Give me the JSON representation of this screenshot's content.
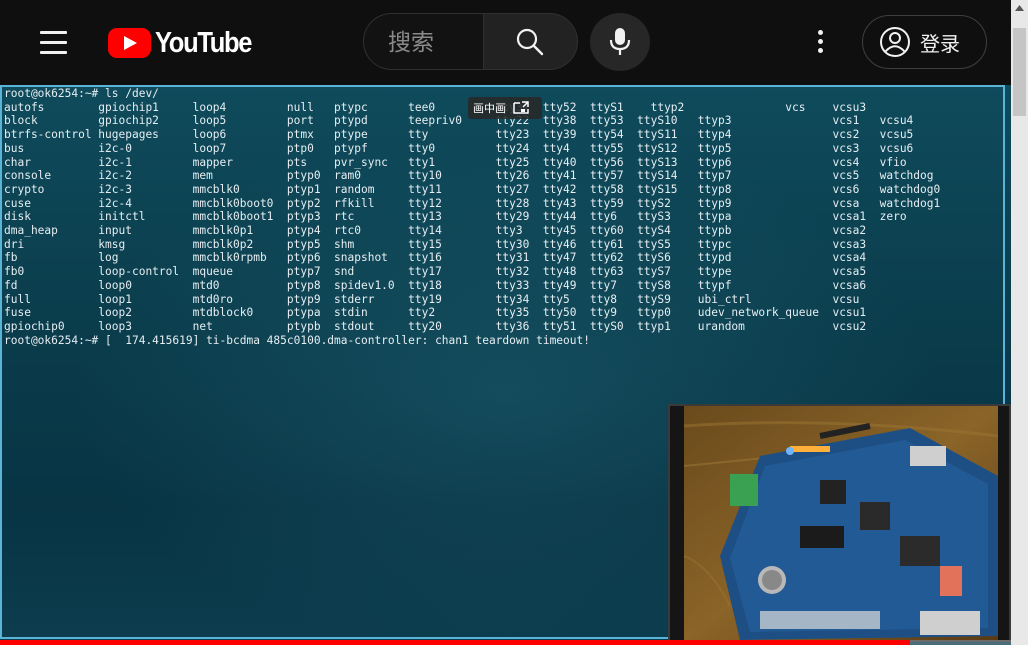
{
  "header": {
    "logo_text": "YouTube",
    "search_placeholder": "搜索",
    "login_label": "登录"
  },
  "video": {
    "pip_badge_label": "画中画",
    "progress_fraction": 0.9,
    "terminal_lines": [
      "root@ok6254:~# ls /dev/",
      "autofs        gpiochip1     loop4         null   ptypc      tee0         tty37  tty52  ttyS1    ttyp2               vcs    vcsu3",
      "block         gpiochip2     loop5         port   ptypd      teepriv0     tty22  tty38  tty53  ttyS10   ttyp3               vcs1   vcsu4",
      "btrfs-control hugepages     loop6         ptmx   ptype      tty          tty23  tty39  tty54  ttyS11   ttyp4               vcs2   vcsu5",
      "bus           i2c-0         loop7         ptp0   ptypf      tty0         tty24  tty4   tty55  ttyS12   ttyp5               vcs3   vcsu6",
      "char          i2c-1         mapper        pts    pvr_sync   tty1         tty25  tty40  tty56  ttyS13   ttyp6               vcs4   vfio",
      "console       i2c-2         mem           ptyp0  ram0       tty10        tty26  tty41  tty57  ttyS14   ttyp7               vcs5   watchdog",
      "crypto        i2c-3         mmcblk0       ptyp1  random     tty11        tty27  tty42  tty58  ttyS15   ttyp8               vcs6   watchdog0",
      "cuse          i2c-4         mmcblk0boot0  ptyp2  rfkill     tty12        tty28  tty43  tty59  ttyS2    ttyp9               vcsa   watchdog1",
      "disk          initctl       mmcblk0boot1  ptyp3  rtc        tty13        tty29  tty44  tty6   ttyS3    ttypa               vcsa1  zero",
      "dma_heap      input         mmcblk0p1     ptyp4  rtc0       tty14        tty3   tty45  tty60  ttyS4    ttypb               vcsa2",
      "dri           kmsg          mmcblk0p2     ptyp5  shm        tty15        tty30  tty46  tty61  ttyS5    ttypc               vcsa3",
      "fb            log           mmcblk0rpmb   ptyp6  snapshot   tty16        tty31  tty47  tty62  ttyS6    ttypd               vcsa4",
      "fb0           loop-control  mqueue        ptyp7  snd        tty17        tty32  tty48  tty63  ttyS7    ttype               vcsa5",
      "fd            loop0         mtd0          ptyp8  spidev1.0  tty18        tty33  tty49  tty7   ttyS8    ttypf               vcsa6",
      "full          loop1         mtd0ro        ptyp9  stderr     tty19        tty34  tty5   tty8   ttyS9    ubi_ctrl            vcsu",
      "fuse          loop2         mtdblock0     ptypa  stdin      tty2         tty35  tty50  tty9   ttyp0    udev_network_queue  vcsu1",
      "gpiochip0     loop3         net           ptypb  stdout     tty20        tty36  tty51  ttyS0  ttyp1    urandom             vcsu2",
      "root@ok6254:~# [  174.415619] ti-bcdma 485c0100.dma-controller: chan1 teardown timeout!"
    ]
  },
  "colors": {
    "brand_red": "#ff0000",
    "terminal_border": "#5ab4d8",
    "terminal_background": "#0b3f4f"
  }
}
